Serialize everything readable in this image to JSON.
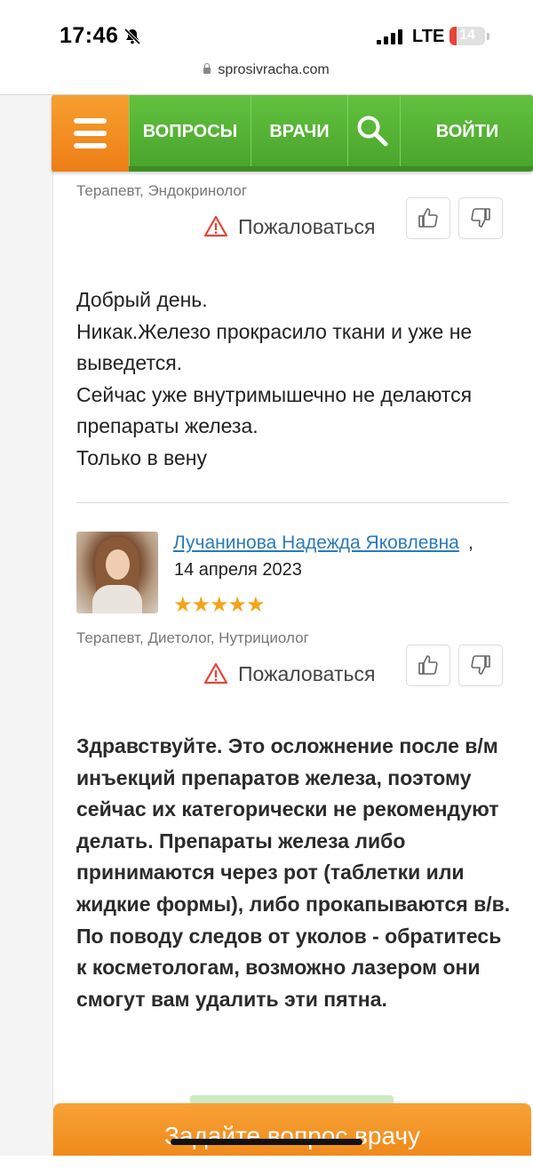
{
  "status_bar": {
    "time": "17:46",
    "network": "LTE",
    "battery": "14",
    "mute_icon": "bell-slash-icon"
  },
  "browser": {
    "url": "sprosivracha.com"
  },
  "nav": {
    "questions": "ВОПРОСЫ",
    "doctors": "ВРАЧИ",
    "login": "ВОЙТИ",
    "menu_icon": "hamburger-icon",
    "search_icon": "search-icon"
  },
  "answer1": {
    "specialties": "Терапевт, Эндокринолог",
    "complain": "Пожаловаться",
    "text": "Добрый день.\nНикак.Железо прокрасило ткани и уже не выведется.\nСейчас уже внутримышечно не делаются препараты железа.\nТолько в вену"
  },
  "answer2": {
    "doctor_name": "Лучанинова Надежда Яковлевна",
    "comma": ",",
    "date": "14 апреля 2023",
    "rating_stars": "★★★★★",
    "specialties": "Терапевт, Диетолог, Нутрициолог",
    "complain": "Пожаловаться",
    "text": "Здравствуйте. Это осложнение после в/м инъекций препаратов железа, поэтому сейчас их категорически не рекомендуют делать. Препараты железа либо принимаются через рот (таблетки или жидкие формы), либо прокапываются в/в.\nПо поводу следов от уколов - обратитесь к косметологам, возможно лазером они смогут вам удалить эти пятна."
  },
  "ask_button": {
    "label": "Задайте вопрос врачу"
  },
  "colors": {
    "nav_green": "#5cba3c",
    "menu_orange": "#f08a1c",
    "link_blue": "#2a7ab8",
    "star_gold": "#f2a51c"
  }
}
